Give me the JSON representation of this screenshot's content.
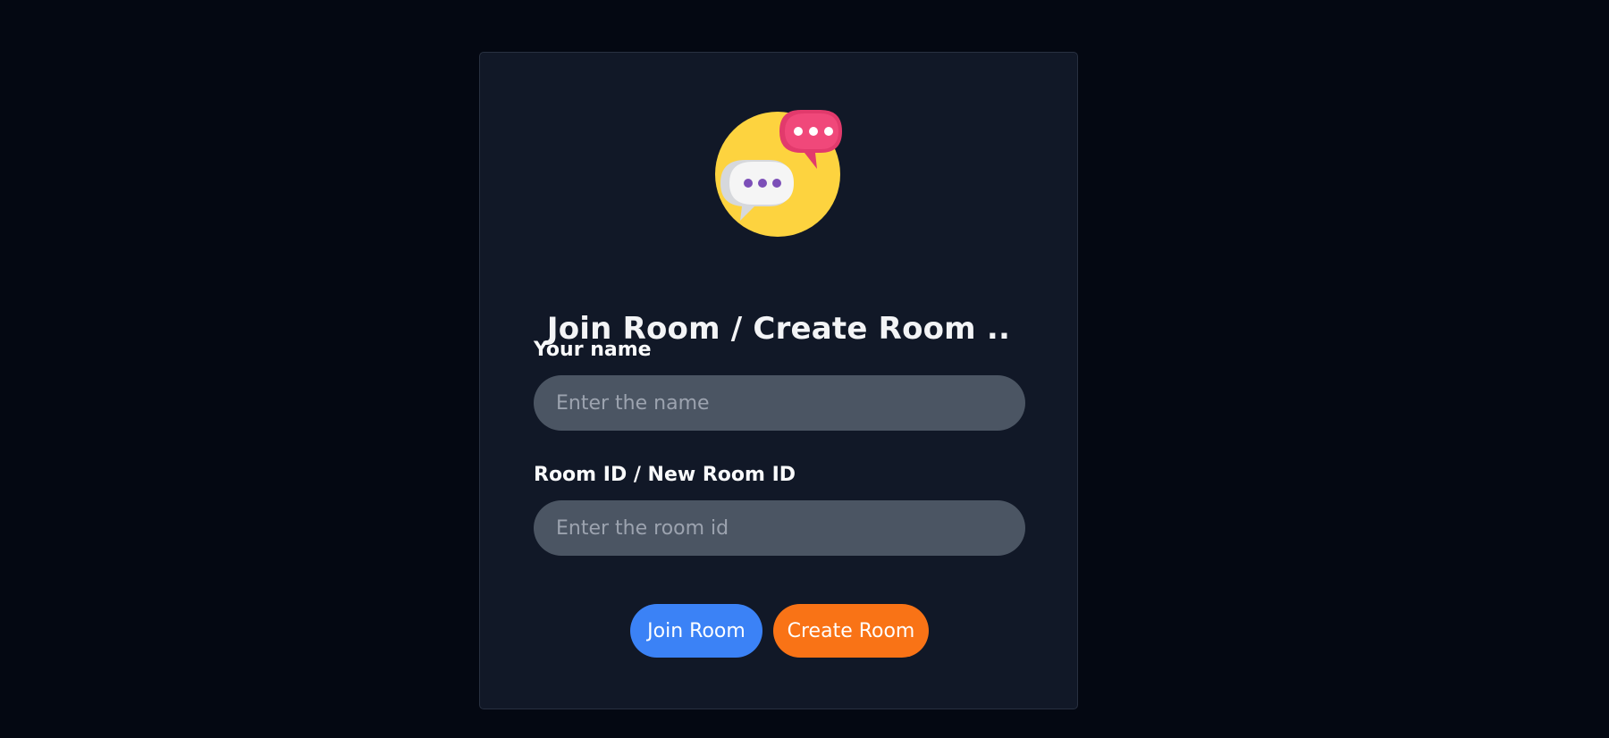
{
  "logo": {
    "icon": "chat-bubbles-icon",
    "colors": {
      "circle": "#fdd33f",
      "front_bubble": "#f5f5f5",
      "front_dots": "#7c4fb8",
      "back_bubble": "#f0487a",
      "back_dots": "#ffffff"
    }
  },
  "title": "Join Room / Create Room ..",
  "form": {
    "name_label": "Your name",
    "name_placeholder": "Enter the name",
    "name_value": "",
    "room_label": "Room ID / New Room ID",
    "room_placeholder": "Enter the room id",
    "room_value": ""
  },
  "buttons": {
    "join_label": "Join Room",
    "create_label": "Create Room",
    "join_color": "#3b82f6",
    "create_color": "#f97316"
  }
}
